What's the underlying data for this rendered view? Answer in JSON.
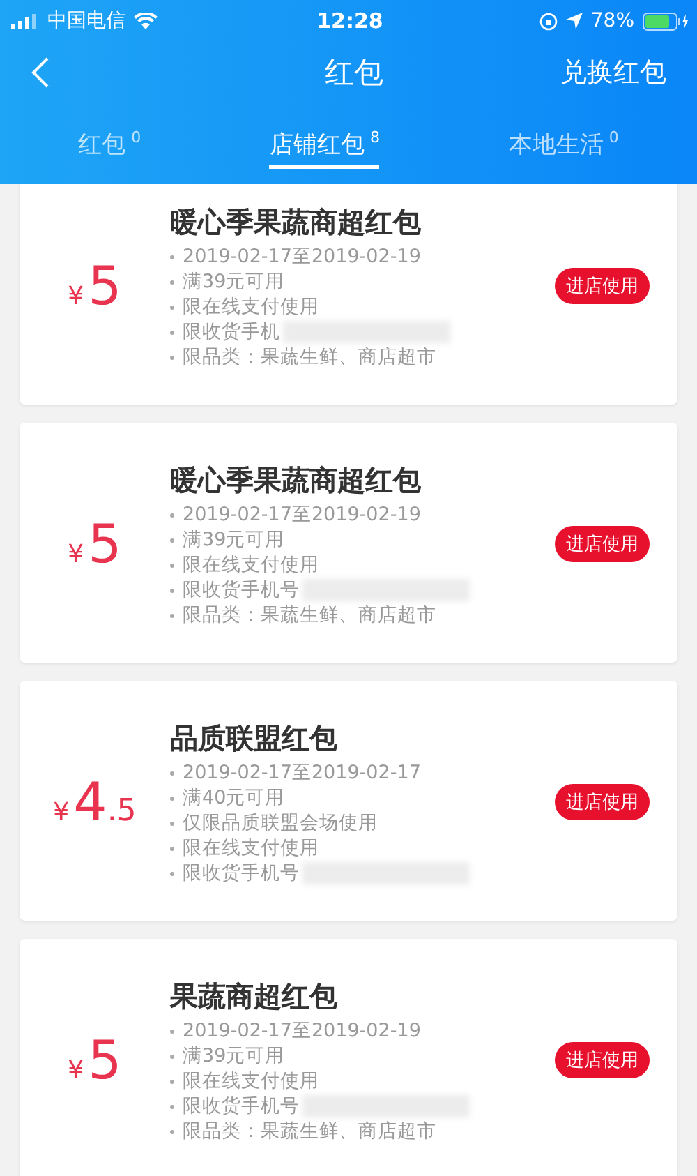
{
  "status_bar": {
    "carrier": "中国电信",
    "time": "12:28",
    "battery": "78%"
  },
  "nav": {
    "title": "红包",
    "action": "兑换红包"
  },
  "tabs": [
    {
      "label": "红包",
      "count": "0",
      "selected": false
    },
    {
      "label": "店铺红包",
      "count": "8",
      "selected": true
    },
    {
      "label": "本地生活",
      "count": "0",
      "selected": false
    }
  ],
  "coupons": [
    {
      "currency": "¥",
      "amount": "5",
      "title": "暖心季果蔬商超红包",
      "button": "进店使用",
      "lines": [
        {
          "text": "2019-02-17至2019-02-19",
          "redacted": false
        },
        {
          "text": "满39元可用",
          "redacted": false
        },
        {
          "text": "限在线支付使用",
          "redacted": false
        },
        {
          "text": "限收货手机",
          "redacted": true
        },
        {
          "text": "限品类：果蔬生鲜、商店超市",
          "redacted": false
        }
      ]
    },
    {
      "currency": "¥",
      "amount": "5",
      "title": "暖心季果蔬商超红包",
      "button": "进店使用",
      "lines": [
        {
          "text": "2019-02-17至2019-02-19",
          "redacted": false
        },
        {
          "text": "满39元可用",
          "redacted": false
        },
        {
          "text": "限在线支付使用",
          "redacted": false
        },
        {
          "text": "限收货手机号",
          "redacted": true
        },
        {
          "text": "限品类：果蔬生鲜、商店超市",
          "redacted": false
        }
      ]
    },
    {
      "currency": "¥",
      "amount": "4",
      "decimal": ".5",
      "title": "品质联盟红包",
      "button": "进店使用",
      "lines": [
        {
          "text": "2019-02-17至2019-02-17",
          "redacted": false
        },
        {
          "text": "满40元可用",
          "redacted": false
        },
        {
          "text": "仅限品质联盟会场使用",
          "redacted": false
        },
        {
          "text": "限在线支付使用",
          "redacted": false
        },
        {
          "text": "限收货手机号",
          "redacted": true
        }
      ]
    },
    {
      "currency": "¥",
      "amount": "5",
      "title": "果蔬商超红包",
      "button": "进店使用",
      "lines": [
        {
          "text": "2019-02-17至2019-02-19",
          "redacted": false
        },
        {
          "text": "满39元可用",
          "redacted": false
        },
        {
          "text": "限在线支付使用",
          "redacted": false
        },
        {
          "text": "限收货手机号",
          "redacted": true
        },
        {
          "text": "限品类：果蔬生鲜、商店超市",
          "redacted": false
        }
      ]
    }
  ]
}
